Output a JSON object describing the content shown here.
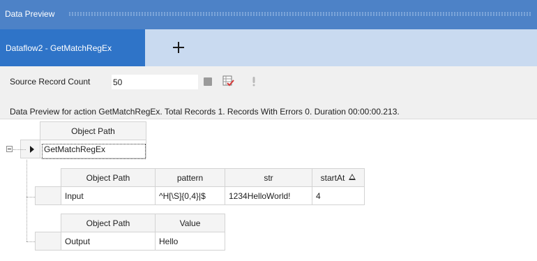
{
  "window": {
    "title": "Data Preview"
  },
  "tabs": [
    {
      "label": "Dataflow2 - GetMatchRegEx"
    }
  ],
  "toolbar": {
    "source_record_count_label": "Source Record Count",
    "source_record_count_value": "50",
    "icons": [
      "stop-icon",
      "grid-check-icon",
      "lightbulb-icon"
    ]
  },
  "status": {
    "text": "Data Preview for action GetMatchRegEx. Total Records 1. Records With Errors 0. Duration 00:00:00.213."
  },
  "grid": {
    "top": {
      "header": "Object Path",
      "row": "GetMatchRegEx"
    },
    "input": {
      "headers": [
        "Object Path",
        "pattern",
        "str",
        "startAt"
      ],
      "row": [
        "Input",
        "^H[\\S]{0,4}|$",
        "1234HelloWorld!",
        "4"
      ]
    },
    "output": {
      "headers": [
        "Object Path",
        "Value"
      ],
      "row": [
        "Output",
        "Hello"
      ]
    }
  },
  "colors": {
    "title_bar": "#4d82c7",
    "tab_strip": "#c9daf0",
    "active_tab": "#2f74c8",
    "toolbar_bg": "#f0f0f0"
  }
}
